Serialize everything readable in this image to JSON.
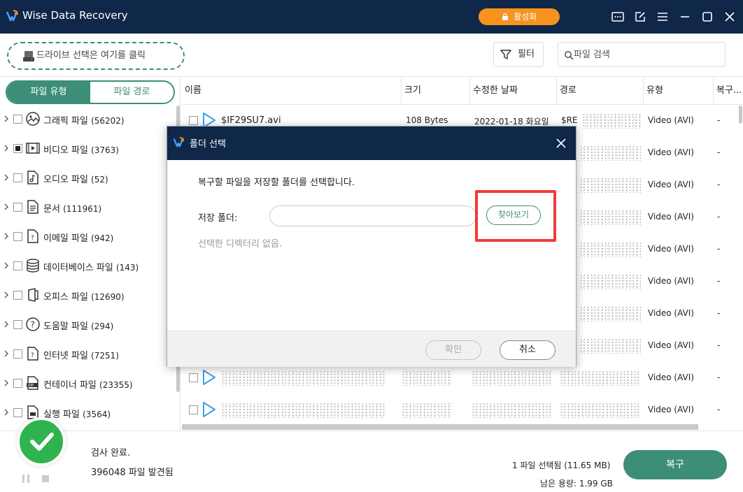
{
  "app": {
    "title": "Wise Data Recovery",
    "activate_label": "활성화"
  },
  "toolbar": {
    "drive_select_label": "드라이브 선택은 여기를 클릭",
    "filter_label": "필터",
    "search_placeholder": "파일 검색"
  },
  "sidebar": {
    "tabs": [
      {
        "label": "파일 유형",
        "active": true
      },
      {
        "label": "파일 경로",
        "active": false
      }
    ],
    "categories": [
      {
        "label": "그래픽 파일",
        "count": "(56202)",
        "icon": "image-file-icon",
        "checked": false
      },
      {
        "label": "비디오 파일",
        "count": "(3763)",
        "icon": "video-file-icon",
        "checked": true
      },
      {
        "label": "오디오 파일",
        "count": "(52)",
        "icon": "audio-file-icon",
        "checked": false
      },
      {
        "label": "문서",
        "count": "(111961)",
        "icon": "document-file-icon",
        "checked": false
      },
      {
        "label": "이메일 파일",
        "count": "(942)",
        "icon": "email-file-icon",
        "checked": false
      },
      {
        "label": "데이터베이스 파일",
        "count": "(143)",
        "icon": "database-icon",
        "checked": false
      },
      {
        "label": "오피스 파일",
        "count": "(12690)",
        "icon": "office-file-icon",
        "checked": false
      },
      {
        "label": "도움말 파일",
        "count": "(294)",
        "icon": "help-file-icon",
        "checked": false
      },
      {
        "label": "인터넷 파일",
        "count": "(7251)",
        "icon": "internet-file-icon",
        "checked": false
      },
      {
        "label": "컨테이너 파일",
        "count": "(23355)",
        "icon": "zip-file-icon",
        "checked": false
      },
      {
        "label": "실행 파일",
        "count": "(3564)",
        "icon": "executable-file-icon",
        "checked": false
      }
    ]
  },
  "filelist": {
    "columns": [
      "이름",
      "크기",
      "수정한 날짜",
      "경로",
      "유형",
      "복구..."
    ],
    "first_row": {
      "name": "$IF29SU7.avi",
      "size": "108 Bytes",
      "date": "2022-01-18 화요일",
      "path": "$RE",
      "type": "Video (AVI)",
      "recoverability": "-"
    },
    "row_type": "Video (AVI)",
    "row_recoverability": "-"
  },
  "footer": {
    "status": "검사 완료.",
    "found": "396048 파일 발견됨",
    "selected": "1 파일 선택됨 (11.65 MB)",
    "free_space": "남은 용량: 1.99 GB",
    "recover_label": "복구"
  },
  "dialog": {
    "title": "폴더 선택",
    "description": "복구할 파일을 저장할 폴더를 선택합니다.",
    "folder_label": "저장 폴더:",
    "folder_value": "",
    "browse_label": "찾아보기",
    "no_directory": "선택한 디렉터리 없음.",
    "ok_label": "확인",
    "cancel_label": "취소"
  },
  "colors": {
    "titlebar": "#0f2748",
    "accent_green": "#3d8e78",
    "activate_orange": "#f7931e",
    "highlight_red": "#f23a3a",
    "success_green": "#2fb34f"
  }
}
